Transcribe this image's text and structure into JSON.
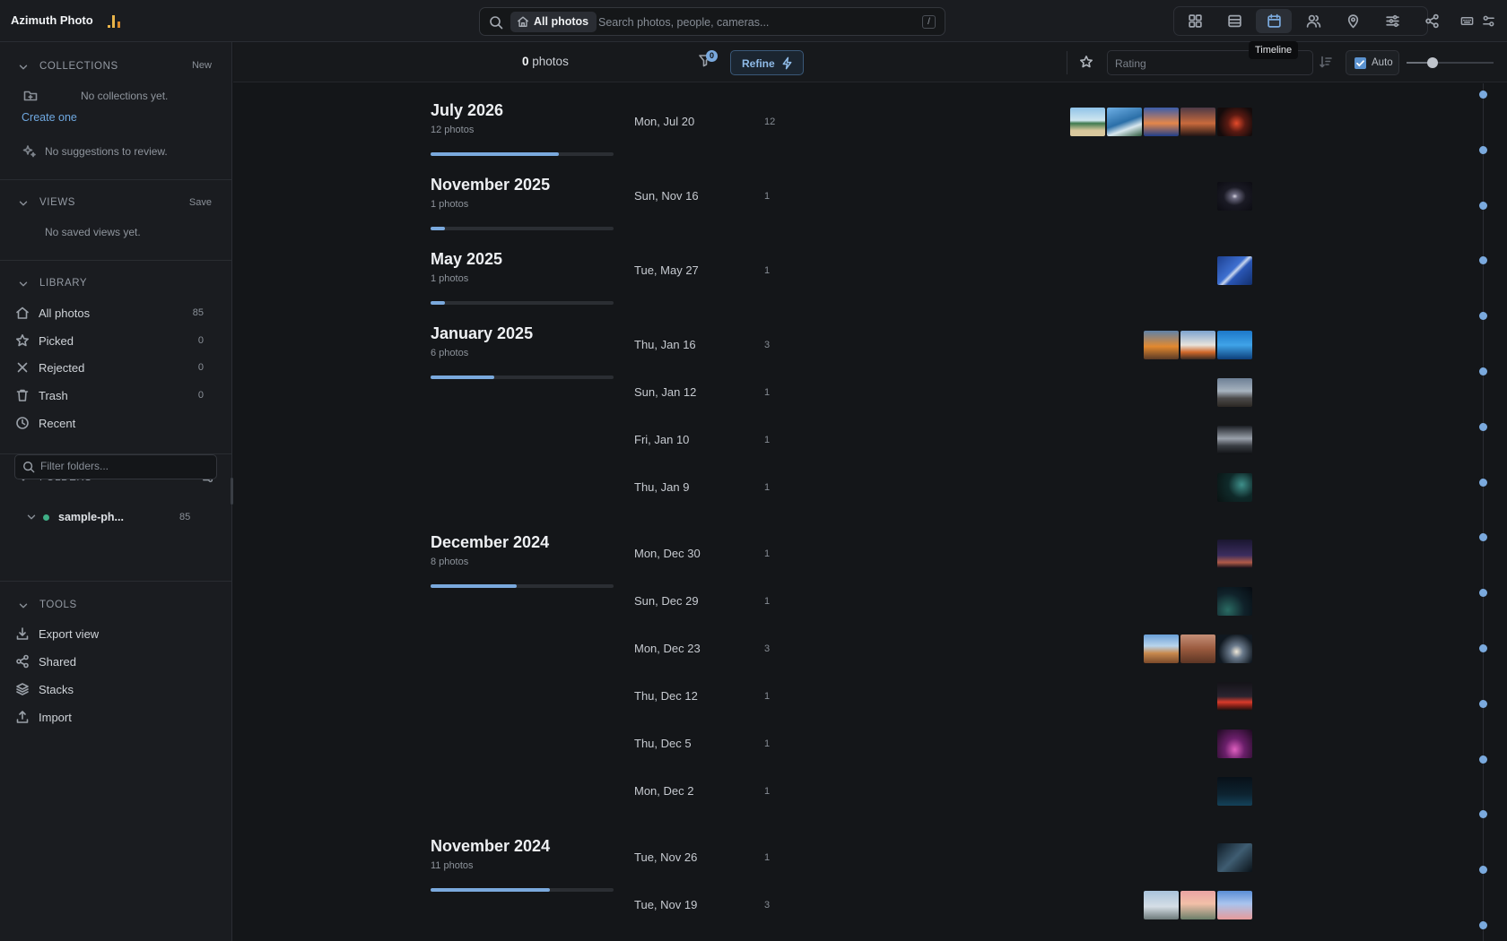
{
  "app": {
    "title": "Azimuth Photo"
  },
  "search": {
    "scope": "All photos",
    "placeholder": "Search photos, people, cameras...",
    "shortcut": "/"
  },
  "view_switcher": [
    {
      "name": "grid-view-button",
      "icon": "grid-icon",
      "active": false
    },
    {
      "name": "list-view-button",
      "icon": "rows-icon",
      "active": false
    },
    {
      "name": "timeline-view-button",
      "icon": "calendar-icon",
      "active": true
    },
    {
      "name": "people-view-button",
      "icon": "people-icon",
      "active": false
    },
    {
      "name": "map-view-button",
      "icon": "map-pin-icon",
      "active": false
    },
    {
      "name": "adjust-view-button",
      "icon": "sliders-icon",
      "active": false
    },
    {
      "name": "share-view-button",
      "icon": "share-icon",
      "active": false
    }
  ],
  "tooltip": "Timeline",
  "colors": {
    "accent": "#7aa9dd",
    "logo_bar_1": "#e8b44a",
    "logo_bar_2": "#d98a2b"
  },
  "sidebar": {
    "collections": {
      "title": "COLLECTIONS",
      "action": "New",
      "empty": "No collections yet.",
      "create_link": "Create one",
      "suggestions": "No suggestions to review."
    },
    "views": {
      "title": "VIEWS",
      "action": "Save",
      "empty": "No saved views yet."
    },
    "library": {
      "title": "LIBRARY",
      "items": [
        {
          "label": "All photos",
          "count": "85",
          "icon": "home-icon"
        },
        {
          "label": "Picked",
          "count": "0",
          "icon": "star-icon"
        },
        {
          "label": "Rejected",
          "count": "0",
          "icon": "x-icon"
        },
        {
          "label": "Trash",
          "count": "0",
          "icon": "trash-icon"
        },
        {
          "label": "Recent",
          "count": "",
          "icon": "clock-icon"
        }
      ]
    },
    "folders": {
      "title": "FOLDERS",
      "filter_placeholder": "Filter folders...",
      "items": [
        {
          "label": "sample-ph...",
          "count": "85"
        }
      ]
    },
    "tools": {
      "title": "TOOLS",
      "items": [
        {
          "label": "Export view",
          "icon": "download-icon"
        },
        {
          "label": "Shared",
          "icon": "share-icon"
        },
        {
          "label": "Stacks",
          "icon": "layers-icon"
        },
        {
          "label": "Import",
          "icon": "upload-icon"
        }
      ]
    }
  },
  "toolbar": {
    "photo_count": "0",
    "photo_count_label": "photos",
    "filter_badge": "0",
    "refine_label": "Refine",
    "rating_placeholder": "Rating",
    "auto_label": "Auto",
    "auto_checked": true,
    "zoom_level": 0.3
  },
  "timeline": {
    "months": [
      {
        "title": "July 2026",
        "subtitle": "12 photos",
        "fill": 0.7,
        "days": [
          {
            "label": "Mon, Jul 20",
            "count": "12",
            "thumbs": [
              "beach",
              "coast",
              "sunset-sea",
              "dusk",
              "fire"
            ]
          }
        ]
      },
      {
        "title": "November 2025",
        "subtitle": "1 photos",
        "fill": 0.08,
        "days": [
          {
            "label": "Sun, Nov 16",
            "count": "1",
            "thumbs": [
              "galaxy"
            ]
          }
        ]
      },
      {
        "title": "May 2025",
        "subtitle": "1 photos",
        "fill": 0.08,
        "days": [
          {
            "label": "Tue, May 27",
            "count": "1",
            "thumbs": [
              "rocket-sky"
            ]
          }
        ]
      },
      {
        "title": "January 2025",
        "subtitle": "6 photos",
        "fill": 0.35,
        "days": [
          {
            "label": "Thu, Jan 16",
            "count": "3",
            "thumbs": [
              "launch-fire",
              "launch-smoke",
              "rocket-blue"
            ]
          },
          {
            "label": "Sun, Jan 12",
            "count": "1",
            "thumbs": [
              "tower-dusk"
            ]
          },
          {
            "label": "Fri, Jan 10",
            "count": "1",
            "thumbs": [
              "tower-night"
            ]
          },
          {
            "label": "Thu, Jan 9",
            "count": "1",
            "thumbs": [
              "night-teal"
            ]
          }
        ]
      },
      {
        "title": "December 2024",
        "subtitle": "8 photos",
        "fill": 0.47,
        "days": [
          {
            "label": "Mon, Dec 30",
            "count": "1",
            "thumbs": [
              "night-purple"
            ]
          },
          {
            "label": "Sun, Dec 29",
            "count": "1",
            "thumbs": [
              "night-sky"
            ]
          },
          {
            "label": "Mon, Dec 23",
            "count": "3",
            "thumbs": [
              "desert",
              "canyon",
              "launch-night"
            ]
          },
          {
            "label": "Thu, Dec 12",
            "count": "1",
            "thumbs": [
              "red-streak"
            ]
          },
          {
            "label": "Thu, Dec 5",
            "count": "1",
            "thumbs": [
              "magenta-arc"
            ]
          },
          {
            "label": "Mon, Dec 2",
            "count": "1",
            "thumbs": [
              "base-sign"
            ]
          }
        ]
      },
      {
        "title": "November 2024",
        "subtitle": "11 photos",
        "fill": 0.65,
        "days": [
          {
            "label": "Tue, Nov 26",
            "count": "1",
            "thumbs": [
              "x-logo"
            ]
          },
          {
            "label": "Tue, Nov 19",
            "count": "3",
            "thumbs": [
              "tower-day",
              "sunrise-pink",
              "rocket-pink"
            ]
          }
        ]
      }
    ]
  }
}
